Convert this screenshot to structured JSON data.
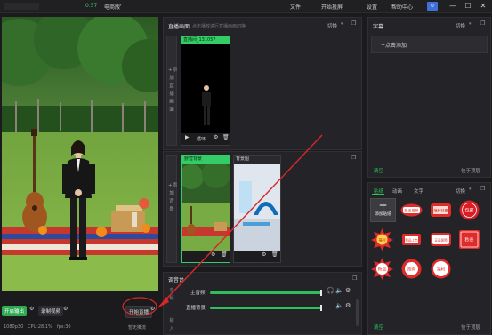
{
  "topbar": {
    "version": "0.57",
    "app_title": "电商版",
    "menu": [
      "文件",
      "开始投屏",
      "设置",
      "帮助中心"
    ]
  },
  "preview": {
    "btn_live_output": "开启输出",
    "btn_record": "录制视频",
    "btn_start_live": "开始直播",
    "status_resolution": "1080p30",
    "status_cpu": "CPU:28.1%",
    "status_fps": "fps:30",
    "status_live": "暂无推流"
  },
  "presenter_panel": {
    "title": "直播画面",
    "subtitle": "点击播放进行直播画面切换",
    "switch_label": "切换",
    "add_label": "+添加直播画面",
    "card_label": "直播间_131057",
    "play_label": "循环"
  },
  "background_panel": {
    "add_label": "+添加背景",
    "card1_label": "野营背景",
    "card2_label": "背景图"
  },
  "mixer": {
    "title": "调音台",
    "rows": [
      {
        "label": "主音频",
        "level": 0.95
      },
      {
        "label": "直播背景",
        "level": 0.95
      }
    ],
    "side_labels": [
      "音",
      "频",
      "输",
      "入"
    ]
  },
  "subtitle_panel": {
    "title": "字幕",
    "switch_label": "切换",
    "add_label": "+点击添加",
    "clear_label": "清空",
    "position_label": "位于顶层"
  },
  "sticker_panel": {
    "tabs": [
      "贴纸",
      "动画",
      "文字"
    ],
    "switch_label": "切换",
    "add_label": "添加贴纸",
    "stickers": [
      "热卖推荐",
      "限时特惠",
      "领取福利",
      "包邮",
      "福利",
      "新品上市",
      "正品保障",
      "秒杀",
      "新品",
      "抢购",
      "福利"
    ],
    "clear_label": "清空",
    "position_label": "位于顶层"
  },
  "colors": {
    "accent": "#2fbf5c",
    "annotation": "#d8262a",
    "background": "#1b1b1d"
  }
}
